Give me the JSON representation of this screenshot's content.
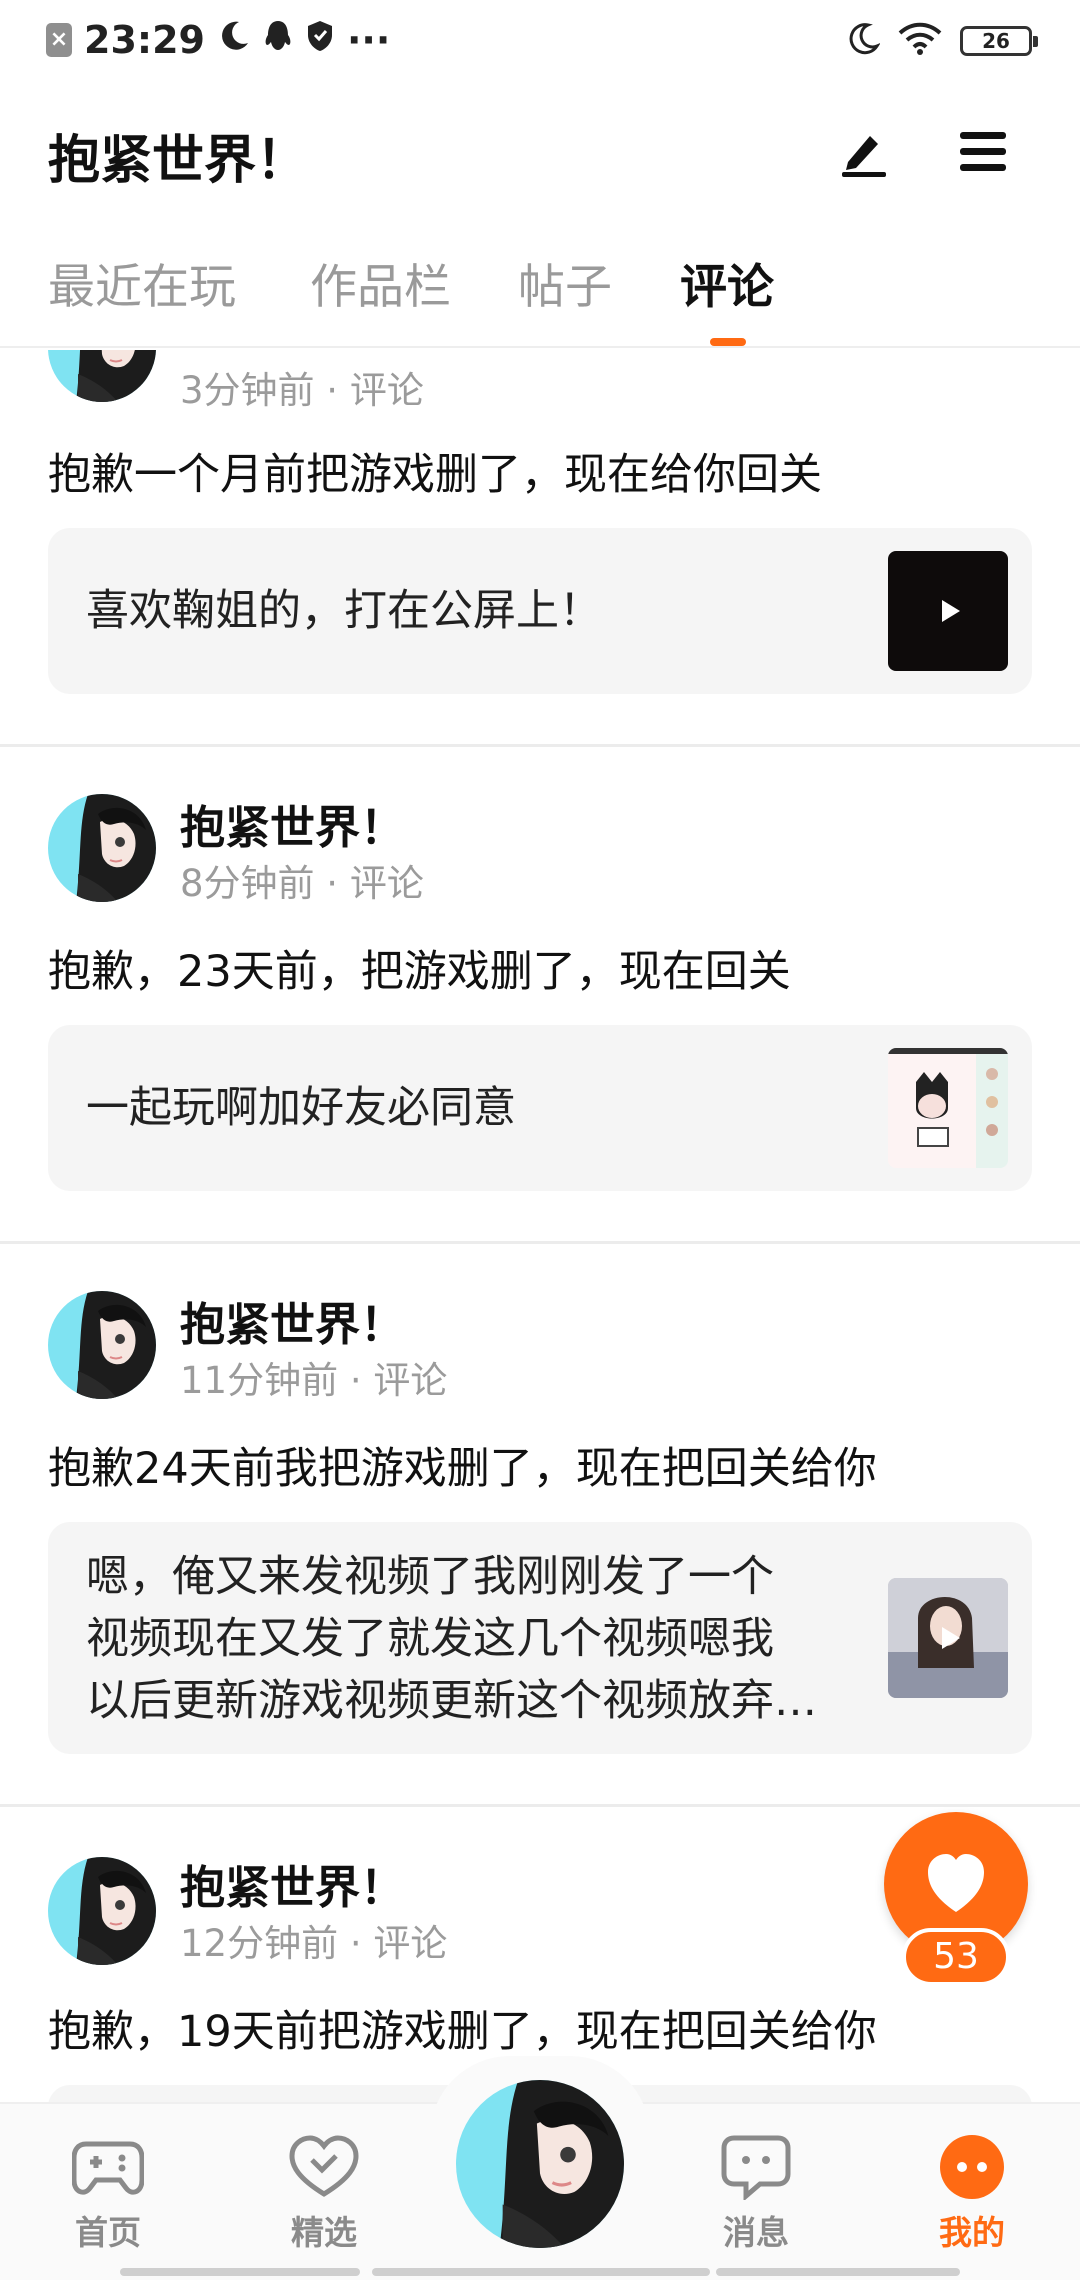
{
  "status_bar": {
    "time": "23:29",
    "notif_badge": "×",
    "more": "···",
    "battery": "26",
    "icons": [
      "moon-icon",
      "qq-icon",
      "shield-icon",
      "moon-icon",
      "wifi-icon",
      "battery-icon"
    ]
  },
  "header": {
    "title": "抱紧世界！",
    "icons": [
      "edit-icon",
      "menu-icon"
    ]
  },
  "tabs": [
    {
      "label": "最近在玩"
    },
    {
      "label": "作品栏"
    },
    {
      "label": "帖子"
    },
    {
      "label": "评论",
      "active": true
    }
  ],
  "posts": [
    {
      "author": "",
      "meta": "3分钟前 · 评论",
      "text": "抱歉一个月前把游戏删了，现在给你回关",
      "quote": "喜欢鞠姐的，打在公屏上！",
      "thumb": "video"
    },
    {
      "author": "抱紧世界！",
      "meta": "8分钟前 · 评论",
      "text": "抱歉，23天前，把游戏删了，现在回关",
      "quote": "一起玩啊加好友必同意",
      "thumb": "image"
    },
    {
      "author": "抱紧世界！",
      "meta": "11分钟前 · 评论",
      "text": "抱歉24天前我把游戏删了，现在把回关给你",
      "quote_lines": [
        "嗯，俺又来发视频了我刚刚发了一个",
        "视频现在又发了就发这几个视频嗯我",
        "以后更新游戏视频更新这个视频放弃…"
      ],
      "thumb": "video"
    },
    {
      "author": "抱紧世界！",
      "meta": "12分钟前 · 评论",
      "text": "抱歉，19天前把游戏删了，现在把回关给你"
    }
  ],
  "like": {
    "count": "53",
    "icon": "heart-icon"
  },
  "bottom_nav": [
    {
      "label": "首页",
      "icon": "gamepad-icon"
    },
    {
      "label": "精选",
      "icon": "heart-check-icon"
    },
    {
      "label": "",
      "icon": "avatar"
    },
    {
      "label": "消息",
      "icon": "chat-icon"
    },
    {
      "label": "我的",
      "icon": "profile-icon",
      "active": true
    }
  ],
  "colors": {
    "accent": "#ff6a13",
    "avatar_bg": "#7fe3f2",
    "meta": "#9b9b9b"
  }
}
